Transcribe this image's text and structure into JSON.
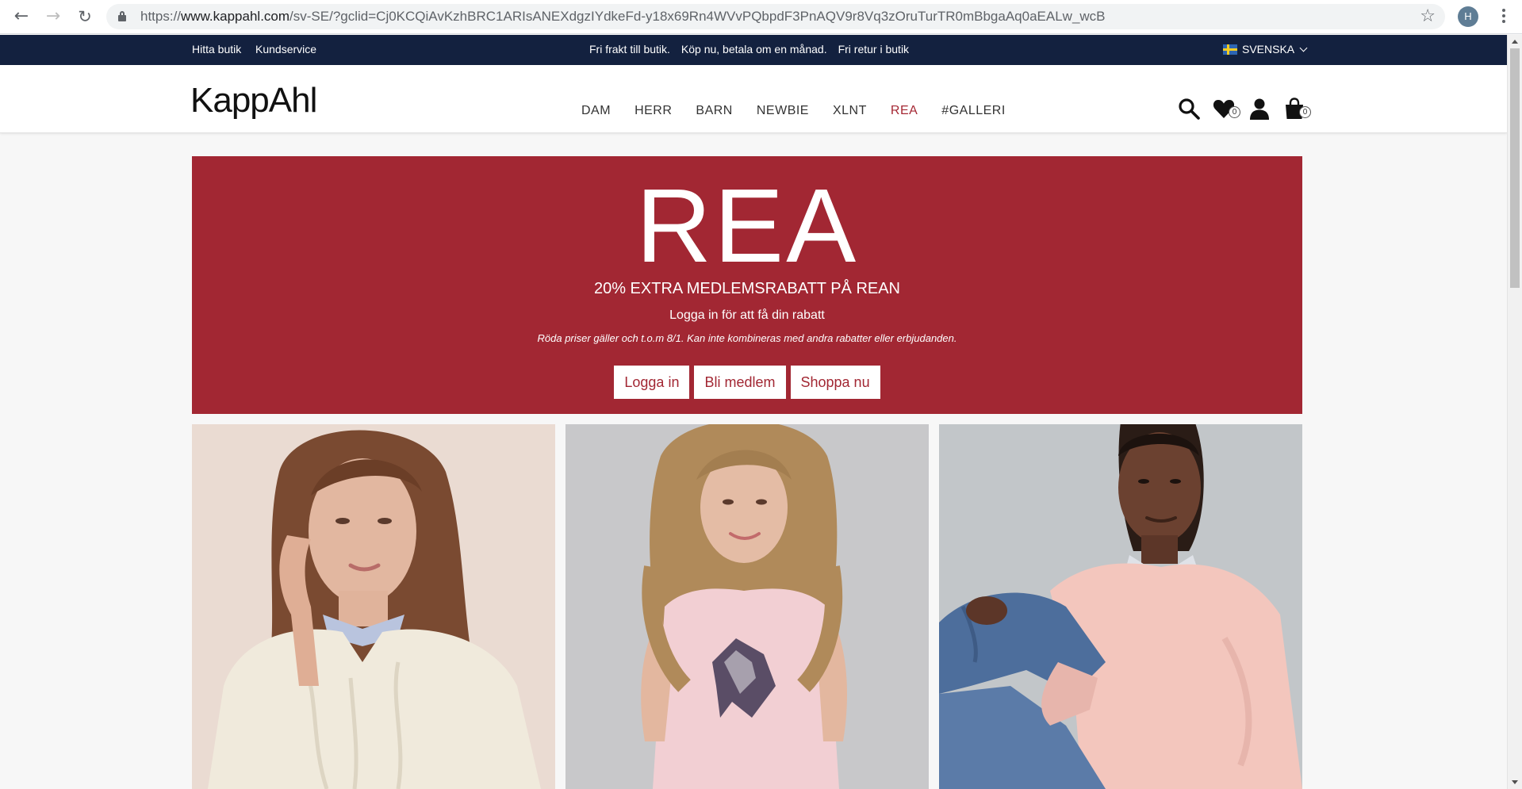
{
  "browser": {
    "url_prefix": "https://",
    "url_host": "www.kappahl.com",
    "url_path": "/sv-SE/?gclid=Cj0KCQiAvKzhBRC1ARIsANEXdgzIYdkeFd-y18x69Rn4WVvPQbpdF3PnAQV9r8Vq3zOruTurTR0mBbgaAq0aEALw_wcB",
    "profile_initial": "H"
  },
  "topbar": {
    "find_store": "Hitta butik",
    "customer_service": "Kundservice",
    "promos": [
      "Fri frakt till butik.",
      "Köp nu, betala om en månad.",
      "Fri retur i butik"
    ],
    "language": "SVENSKA"
  },
  "header": {
    "logo": "KappAhl",
    "nav": [
      "DAM",
      "HERR",
      "BARN",
      "NEWBIE",
      "XLNT",
      "REA",
      "#GALLERI"
    ],
    "wishlist_count": "0",
    "cart_count": "0"
  },
  "sale_banner": {
    "title": "REA",
    "subtitle": "20% EXTRA MEDLEMSRABATT PÅ REAN",
    "login_text": "Logga in för att få din rabatt",
    "terms": "Röda priser gäller och t.o.m 8/1. Kan inte kombineras med andra rabatter eller erbjudanden.",
    "buttons": [
      "Logga in",
      "Bli medlem",
      "Shoppa nu"
    ]
  },
  "colors": {
    "topbar_bg": "#13213f",
    "sale_red": "#a22733",
    "nav_sale": "#a52834"
  }
}
